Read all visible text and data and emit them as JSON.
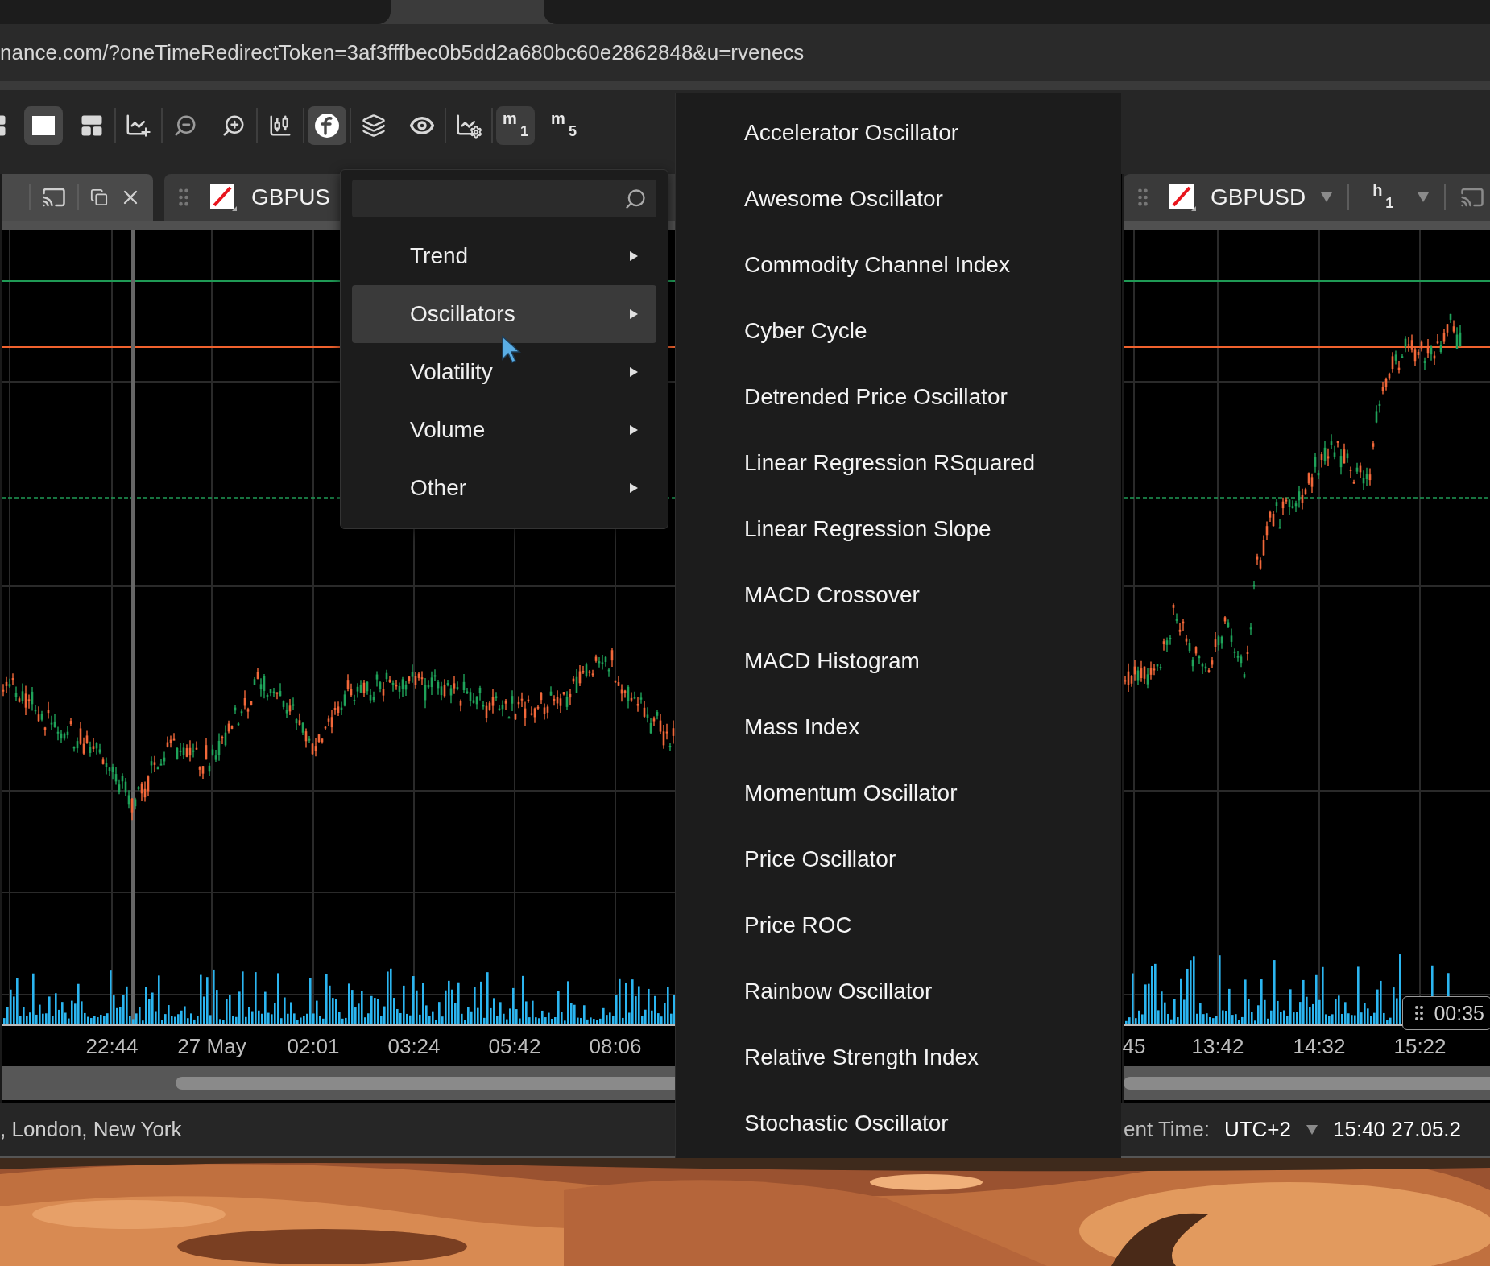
{
  "browser": {
    "url": "nance.com/?oneTimeRedirectToken=3af3fffbec0b5dd2a680bc60e2862848&u=rvenecs"
  },
  "toolbar": {
    "groups": [
      [
        {
          "kind": "grid",
          "selected": false
        },
        {
          "kind": "single",
          "selected": true
        },
        {
          "kind": "split",
          "selected": false
        }
      ],
      [
        {
          "kind": "add-chart",
          "selected": false
        }
      ],
      [
        {
          "kind": "zoom-out",
          "selected": false
        },
        {
          "kind": "zoom-in",
          "selected": false
        }
      ],
      [
        {
          "kind": "candles",
          "selected": false
        }
      ],
      [
        {
          "kind": "function",
          "selected": true
        }
      ],
      [
        {
          "kind": "layers",
          "selected": false
        },
        {
          "kind": "eye",
          "selected": false
        }
      ],
      [
        {
          "kind": "chart-settings",
          "selected": false
        }
      ],
      [
        {
          "kind": "timeframe",
          "unit": "m",
          "value": "1",
          "selected": true
        },
        {
          "kind": "timeframe",
          "unit": "m",
          "value": "5",
          "selected": false
        }
      ]
    ]
  },
  "chart_panels": [
    {
      "symbol": "GBPUS",
      "x_axis": [
        "22:44",
        "27 May",
        "02:01",
        "03:24",
        "05:42",
        "08:06"
      ]
    },
    {
      "symbol": "GBPUSD",
      "timeframe": {
        "unit": "h",
        "value": "1"
      },
      "x_axis": [
        "45",
        "13:42",
        "14:32",
        "15:22"
      ],
      "time_badge": "00:35"
    }
  ],
  "indicator_menu": {
    "categories": [
      {
        "label": "Trend",
        "selected": false
      },
      {
        "label": "Oscillators",
        "selected": true
      },
      {
        "label": "Volatility",
        "selected": false
      },
      {
        "label": "Volume",
        "selected": false
      },
      {
        "label": "Other",
        "selected": false
      }
    ]
  },
  "indicator_submenu": {
    "items": [
      "Accelerator Oscillator",
      "Awesome Oscillator",
      "Commodity Channel Index",
      "Cyber Cycle",
      "Detrended Price Oscillator",
      "Linear Regression RSquared",
      "Linear Regression Slope",
      "MACD Crossover",
      "MACD Histogram",
      "Mass Index",
      "Momentum Oscillator",
      "Price Oscillator",
      "Price ROC",
      "Rainbow Oscillator",
      "Relative Strength Index",
      "Stochastic Oscillator"
    ]
  },
  "status_bar": {
    "sessions": ", London, New York",
    "time_label": "ent Time:",
    "timezone": "UTC+2",
    "datetime": "15:40 27.05.2"
  }
}
